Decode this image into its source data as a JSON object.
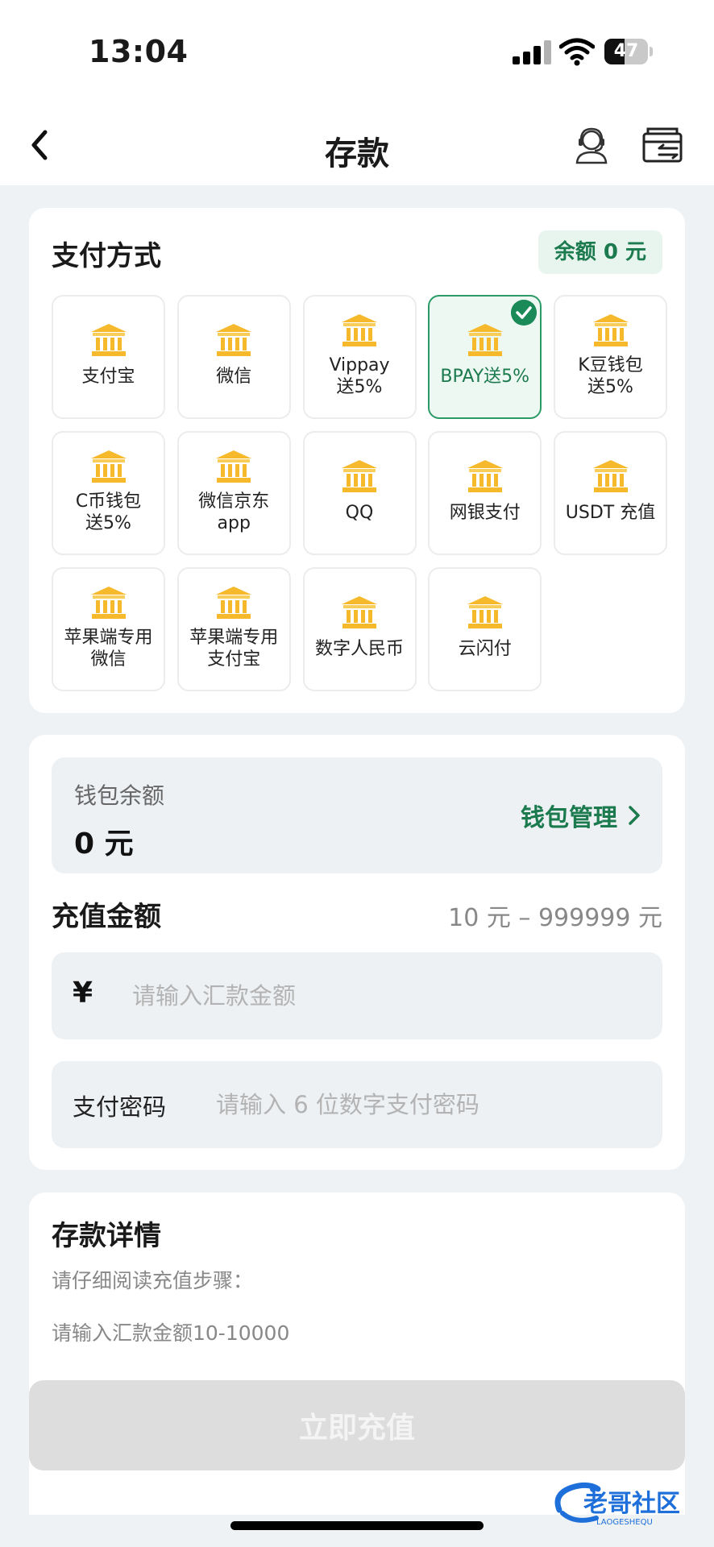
{
  "status_bar": {
    "time": "13:04",
    "battery": "47",
    "battery_level": 0.47
  },
  "nav": {
    "title": "存款",
    "back_icon": "chevron-left-icon",
    "service_icon": "customer-service-icon",
    "wallet_icon": "wallet-icon"
  },
  "payment": {
    "title": "支付方式",
    "balance_badge": "余额 0 元",
    "selected_index": 3,
    "methods": [
      {
        "label": "支付宝"
      },
      {
        "label": "微信"
      },
      {
        "label": "Vippay\n送5%"
      },
      {
        "label": "BPAY送5%"
      },
      {
        "label": "K豆钱包\n送5%"
      },
      {
        "label": "C币钱包\n送5%"
      },
      {
        "label": "微信京东\napp"
      },
      {
        "label": "QQ"
      },
      {
        "label": "网银支付"
      },
      {
        "label": "USDT 充值"
      },
      {
        "label": "苹果端专用\n微信"
      },
      {
        "label": "苹果端专用\n支付宝"
      },
      {
        "label": "数字人民币"
      },
      {
        "label": "云闪付"
      }
    ]
  },
  "wallet": {
    "label": "钱包余额",
    "value": "0 元",
    "manage_label": "钱包管理"
  },
  "amount": {
    "title": "充值金额",
    "range": "10 元 – 999999 元",
    "currency": "¥",
    "amount_placeholder": "请输入汇款金额",
    "pwd_label": "支付密码",
    "pwd_placeholder": "请输入 6 位数字支付密码"
  },
  "details": {
    "title": "存款详情",
    "line1": "请仔细阅读充值步骤：",
    "line2": "请输入汇款金额10-10000"
  },
  "submit": {
    "label": "立即充值"
  },
  "watermark": {
    "text": "老哥社区",
    "sub": "LAOGESHEQU"
  },
  "colors": {
    "accent": "#1b7a4e",
    "icon_gold": "#f6b92b",
    "background": "#eef2f5"
  }
}
